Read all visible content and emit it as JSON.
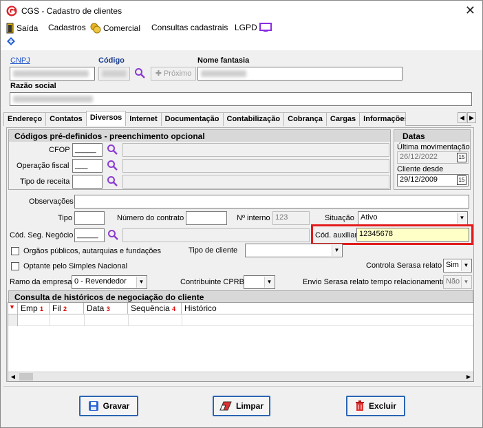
{
  "window": {
    "title": "CGS - Cadastro de clientes",
    "close": "✕"
  },
  "menu": {
    "saida": "Saída",
    "cadastros": "Cadastros",
    "comercial": "Comercial",
    "consultas": "Consultas cadastrais",
    "lgpd": "LGPD"
  },
  "header": {
    "cnpj_label": "CNPJ",
    "codigo_label": "Código",
    "proximo_label": "Próximo",
    "nome_fantasia_label": "Nome fantasia",
    "razao_social_label": "Razão social"
  },
  "tabs": [
    "Endereço",
    "Contatos",
    "Diversos",
    "Internet",
    "Documentação",
    "Contabilização",
    "Cobrança",
    "Cargas",
    "Informações Adi"
  ],
  "codigos": {
    "title": "Códigos pré-definidos - preenchimento opcional",
    "cfop_label": "CFOP",
    "cfop_value": "_____",
    "operacao_label": "Operação fiscal",
    "operacao_value": "___",
    "tipo_receita_label": "Tipo de receita"
  },
  "datas": {
    "title": "Datas",
    "ultima_label": "Última movimentação",
    "ultima_value": "26/12/2022",
    "cliente_desde_label": "Cliente desde",
    "cliente_desde_value": "29/12/2009",
    "cal_icon_text": "15"
  },
  "form": {
    "observacoes_label": "Observações",
    "tipo_label": "Tipo",
    "contrato_label": "Número do contrato",
    "interno_label": "Nº interno",
    "interno_value": "123",
    "situacao_label": "Situação",
    "situacao_value": "Ativo",
    "cod_seg_label": "Cód. Seg. Negócio",
    "cod_seg_value": "_____",
    "cod_aux_label": "Cód. auxiliar",
    "cod_aux_value": "12345678",
    "orgaos_label": "Orgãos públicos, autarquias e fundações",
    "tipo_cliente_label": "Tipo de cliente",
    "optante_label": "Optante pelo Simples Nacional",
    "serasa_label": "Controla Serasa relato",
    "serasa_value": "Sim",
    "ramo_label": "Ramo da empresa",
    "ramo_value": "0 - Revendedor",
    "cprb_label": "Contribuinte CPRB",
    "envio_label": "Envio Serasa relato tempo relacionamento",
    "envio_value": "Não"
  },
  "historico": {
    "title": "Consulta de históricos de negociação do cliente",
    "columns": [
      {
        "label": "Emp",
        "sort": "1"
      },
      {
        "label": "Fil",
        "sort": "2"
      },
      {
        "label": "Data",
        "sort": "3"
      },
      {
        "label": "Sequência",
        "sort": "4"
      },
      {
        "label": "Histórico",
        "sort": ""
      }
    ]
  },
  "buttons": {
    "gravar": "Gravar",
    "limpar": "Limpar",
    "excluir": "Excluir"
  },
  "colors": {
    "highlight": "#e31b1b",
    "accent": "#2a64b4",
    "aux_field_bg": "#ffffc8"
  }
}
